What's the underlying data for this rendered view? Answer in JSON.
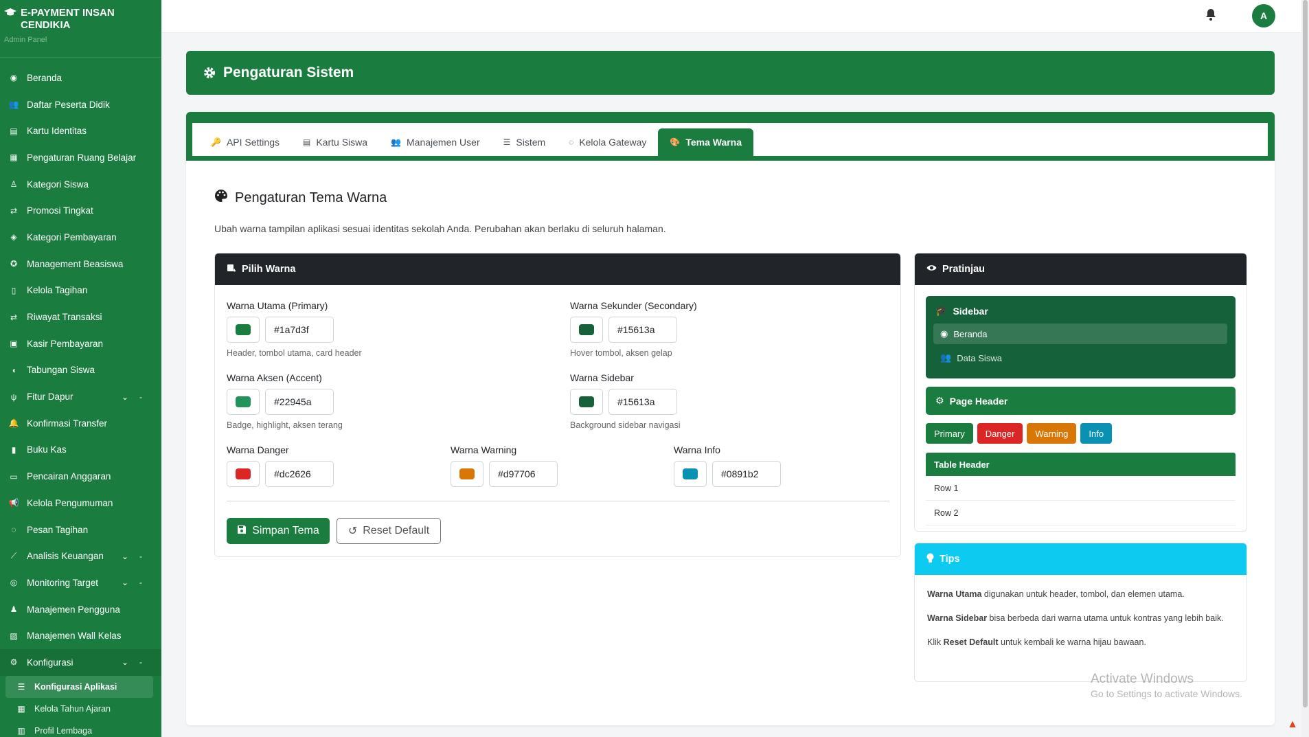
{
  "app": {
    "brand_title": "E-PAYMENT INSAN CENDIKIA",
    "brand_subtitle": "Admin Panel",
    "avatar_initial": "A"
  },
  "sidebar": {
    "items": [
      {
        "label": "Beranda",
        "icon": "dashboard-icon"
      },
      {
        "label": "Daftar Peserta Didik",
        "icon": "users-icon"
      },
      {
        "label": "Kartu Identitas",
        "icon": "id-card-icon"
      },
      {
        "label": "Pengaturan Ruang Belajar",
        "icon": "school-icon"
      },
      {
        "label": "Kategori Siswa",
        "icon": "person-icon"
      },
      {
        "label": "Promosi Tingkat",
        "icon": "exchange-icon"
      },
      {
        "label": "Kategori Pembayaran",
        "icon": "tag-icon"
      },
      {
        "label": "Management Beasiswa",
        "icon": "award-icon"
      },
      {
        "label": "Kelola Tagihan",
        "icon": "file-icon"
      },
      {
        "label": "Riwayat Transaksi",
        "icon": "exchange-icon"
      },
      {
        "label": "Kasir Pembayaran",
        "icon": "cash-register-icon"
      },
      {
        "label": "Tabungan Siswa",
        "icon": "piggy-bank-icon"
      },
      {
        "label": "Fitur Dapur",
        "icon": "utensils-icon"
      },
      {
        "label": "Konfirmasi Transfer",
        "icon": "bell-icon"
      },
      {
        "label": "Buku Kas",
        "icon": "book-icon"
      },
      {
        "label": "Pencairan Anggaran",
        "icon": "wallet-icon"
      },
      {
        "label": "Kelola Pengumuman",
        "icon": "megaphone-icon"
      },
      {
        "label": "Pesan Tagihan",
        "icon": "whatsapp-icon"
      },
      {
        "label": "Analisis Keuangan",
        "icon": "chart-icon"
      },
      {
        "label": "Monitoring Target",
        "icon": "target-icon"
      },
      {
        "label": "Manajemen Pengguna",
        "icon": "user-cog-icon"
      },
      {
        "label": "Manajemen Wall Kelas",
        "icon": "chalkboard-icon"
      },
      {
        "label": "Konfigurasi",
        "icon": "gear-icon"
      }
    ],
    "sub_items": [
      {
        "label": "Konfigurasi Aplikasi",
        "icon": "sliders-icon"
      },
      {
        "label": "Kelola Tahun Ajaran",
        "icon": "calendar-icon"
      },
      {
        "label": "Profil Lembaga",
        "icon": "building-icon"
      }
    ]
  },
  "page": {
    "header_title": "Pengaturan Sistem",
    "tabs": [
      {
        "label": "API Settings",
        "icon": "key-icon"
      },
      {
        "label": "Kartu Siswa",
        "icon": "id-card-icon"
      },
      {
        "label": "Manajemen User",
        "icon": "users-icon"
      },
      {
        "label": "Sistem",
        "icon": "server-icon"
      },
      {
        "label": "Kelola Gateway",
        "icon": "whatsapp-icon"
      },
      {
        "label": "Tema Warna",
        "icon": "palette-icon"
      }
    ],
    "section_title": "Pengaturan Tema Warna",
    "section_desc": "Ubah warna tampilan aplikasi sesuai identitas sekolah Anda. Perubahan akan berlaku di seluruh halaman."
  },
  "picker": {
    "title": "Pilih Warna",
    "primary": {
      "label": "Warna Utama (Primary)",
      "value": "#1a7d3f",
      "hint": "Header, tombol utama, card header"
    },
    "secondary": {
      "label": "Warna Sekunder (Secondary)",
      "value": "#15613a",
      "hint": "Hover tombol, aksen gelap"
    },
    "accent": {
      "label": "Warna Aksen (Accent)",
      "value": "#22945a",
      "hint": "Badge, highlight, aksen terang"
    },
    "sidebar": {
      "label": "Warna Sidebar",
      "value": "#15613a",
      "hint": "Background sidebar navigasi"
    },
    "danger": {
      "label": "Warna Danger",
      "value": "#dc2626"
    },
    "warning": {
      "label": "Warna Warning",
      "value": "#d97706"
    },
    "info": {
      "label": "Warna Info",
      "value": "#0891b2"
    },
    "save_label": "Simpan Tema",
    "reset_label": "Reset Default"
  },
  "preview": {
    "title": "Pratinjau",
    "sidebar_title": "Sidebar",
    "sidebar_active": "Beranda",
    "sidebar_item": "Data Siswa",
    "page_header": "Page Header",
    "buttons": [
      "Primary",
      "Danger",
      "Warning",
      "Info"
    ],
    "table_header": "Table Header",
    "rows": [
      "Row 1",
      "Row 2"
    ]
  },
  "tips": {
    "title": "Tips",
    "tip1_bold": "Warna Utama",
    "tip1_text": " digunakan untuk header, tombol, dan elemen utama.",
    "tip2_bold": "Warna Sidebar",
    "tip2_text": " bisa berbeda dari warna utama untuk kontras yang lebih baik.",
    "tip3_pre": "Klik ",
    "tip3_bold": "Reset Default",
    "tip3_text": " untuk kembali ke warna hijau bawaan."
  },
  "watermark": {
    "line1": "Activate Windows",
    "line2": "Go to Settings to activate Windows."
  }
}
